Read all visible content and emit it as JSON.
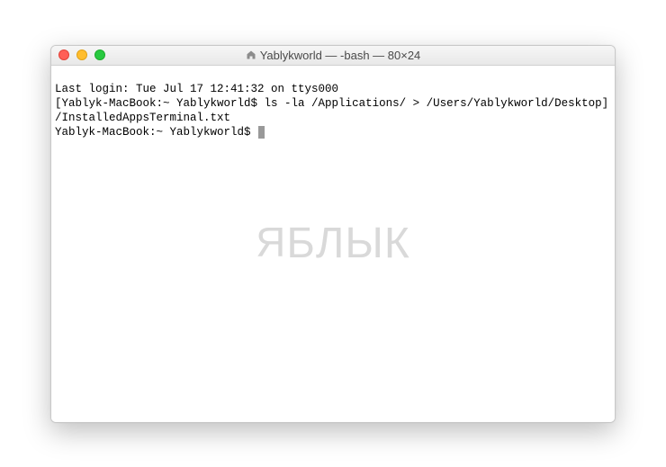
{
  "window": {
    "title": "Yablykworld — -bash — 80×24"
  },
  "terminal": {
    "last_login": "Last login: Tue Jul 17 12:41:32 on ttys000",
    "line1_prompt": "[Yablyk-MacBook:~ Yablykworld$ ",
    "line1_cmd": "ls -la /Applications/ > /Users/Yablykworld/Desktop]",
    "line2": "/InstalledAppsTerminal.txt",
    "line3_prompt": "Yablyk-MacBook:~ Yablykworld$ "
  },
  "watermark": {
    "text": "БЛЫК"
  }
}
